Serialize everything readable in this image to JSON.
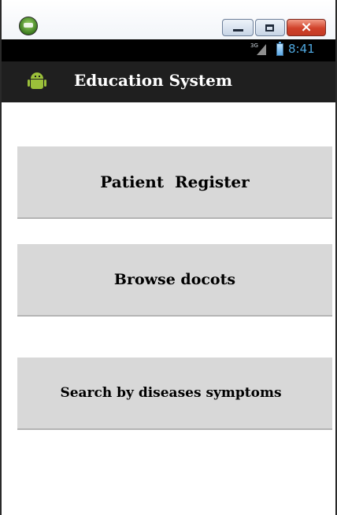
{
  "window": {
    "close_label": "×"
  },
  "status_bar": {
    "network_label": "3G",
    "time": "8:41"
  },
  "action_bar": {
    "title": "Education System"
  },
  "menu": {
    "buttons": [
      {
        "label": "Patient  Register"
      },
      {
        "label": "Browse docots"
      },
      {
        "label": "Search by diseases symptoms"
      }
    ]
  },
  "colors": {
    "action_bar_bg": "#1f1f1f",
    "status_bar_bg": "#000000",
    "button_bg": "#d8d8d8",
    "clock_color": "#4fa8e0",
    "android_green": "#9bc03a"
  },
  "icons": [
    "emulator-logo-icon",
    "minimize-icon",
    "maximize-icon",
    "close-icon",
    "signal-icon",
    "battery-icon",
    "android-app-icon"
  ]
}
